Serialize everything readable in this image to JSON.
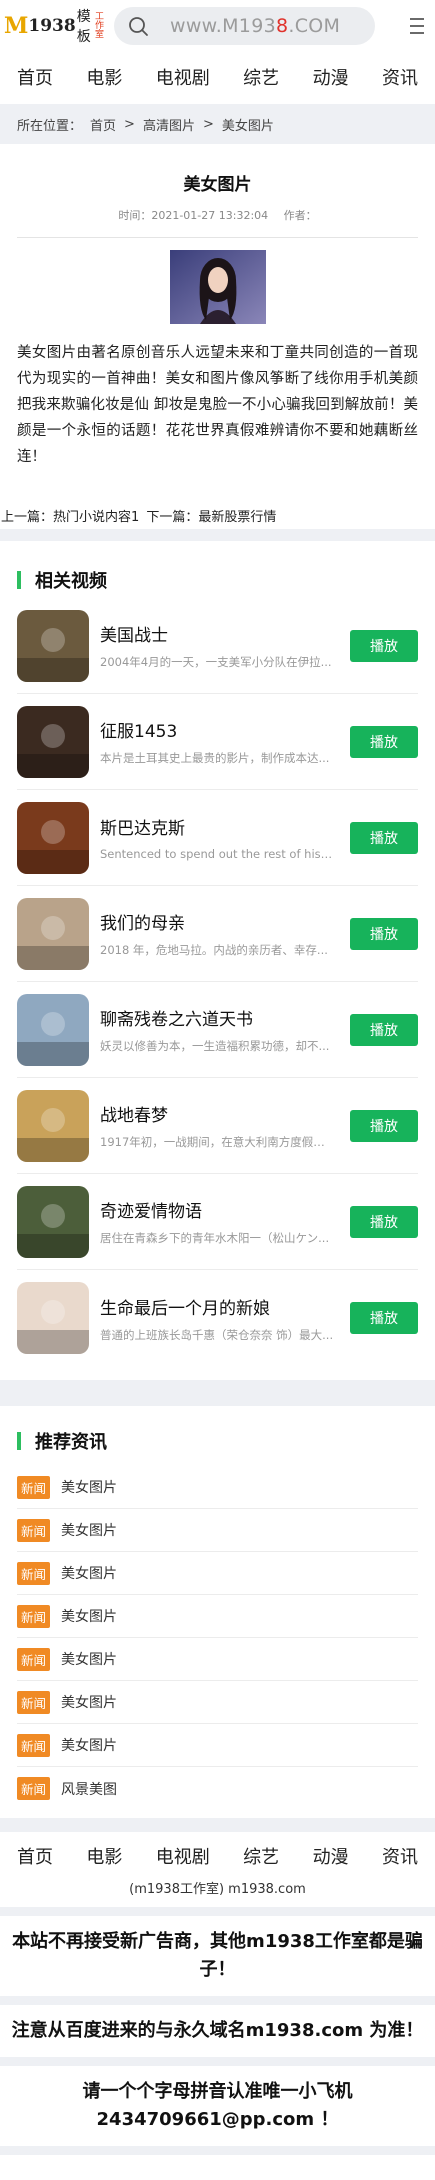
{
  "header": {
    "logo_m": "M",
    "logo_num": "1938",
    "logo_cn": "模板",
    "logo_stamp": "工作室",
    "search_url_a": "www.M193",
    "search_url_b": "8",
    "search_url_c": ".COM"
  },
  "nav": [
    "首页",
    "电影",
    "电视剧",
    "综艺",
    "动漫",
    "资讯"
  ],
  "breadcrumb": {
    "prefix": "所在位置：",
    "home": "首页",
    "sep1": ">",
    "cat": "高清图片",
    "sep2": ">",
    "current": "美女图片"
  },
  "article": {
    "title": "美女图片",
    "time": "时间：2021-01-27 13:32:04",
    "author": "作者：",
    "body": "美女图片由著名原创音乐人远望未来和丁童共同创造的一首现代为现实的一首神曲！美女和图片像风筝断了线你用手机美颜把我来欺骗化妆是仙 卸妆是鬼脸一不小心骗我回到解放前！美颜是一个永恒的话题！花花世界真假难辨请你不要和她藕断丝连！",
    "prev": "上一篇：热门小说内容1",
    "next": "下一篇：最新股票行情"
  },
  "videos": {
    "heading": "相关视频",
    "play_label": "播放",
    "items": [
      {
        "title": "美国战士",
        "desc": "2004年4月的一天，一支美军小分队在伊拉..."
      },
      {
        "title": "征服1453",
        "desc": "本片是土耳其史上最贵的影片，制作成本达..."
      },
      {
        "title": "斯巴达克斯",
        "desc": "Sentenced to spend out the rest of his a..."
      },
      {
        "title": "我们的母亲",
        "desc": "2018 年，危地马拉。内战的亲历者、幸存..."
      },
      {
        "title": "聊斋残卷之六道天书",
        "desc": "妖灵以修善为本，一生造福积累功德，却不..."
      },
      {
        "title": "战地春梦",
        "desc": "1917年初，一战期间，在意大利南方度假归..."
      },
      {
        "title": "奇迹爱情物语",
        "desc": "居住在青森乡下的青年水木阳一（松山ケン..."
      },
      {
        "title": "生命最后一个月的新娘",
        "desc": "普通的上班族长岛千惠（荣仓奈奈 饰）最大..."
      }
    ],
    "thumb_colors": [
      "#6b5a3e",
      "#3b2a20",
      "#7a3a1c",
      "#b9a38a",
      "#8fa8c0",
      "#c9a25a",
      "#4c5e3a",
      "#e9d9cc"
    ]
  },
  "news": {
    "heading": "推荐资讯",
    "badge": "新闻",
    "items": [
      "美女图片",
      "美女图片",
      "美女图片",
      "美女图片",
      "美女图片",
      "美女图片",
      "美女图片",
      "风景美图"
    ]
  },
  "footer": {
    "copy": "(m1938工作室) m1938.com",
    "notice1": "本站不再接受新广告商，其他m1938工作室都是骗子！",
    "notice2": "注意从百度进来的与永久域名m1938.com 为准！",
    "notice3": "请一个个字母拼音认准唯一小飞机 2434709661@pp.com ！"
  },
  "colors": {
    "accent_green": "#17b35b",
    "section_bar": "#2dbe60",
    "badge_orange": "#f08a24",
    "logo_gold": "#e8a600",
    "url_red": "#e0322b"
  }
}
